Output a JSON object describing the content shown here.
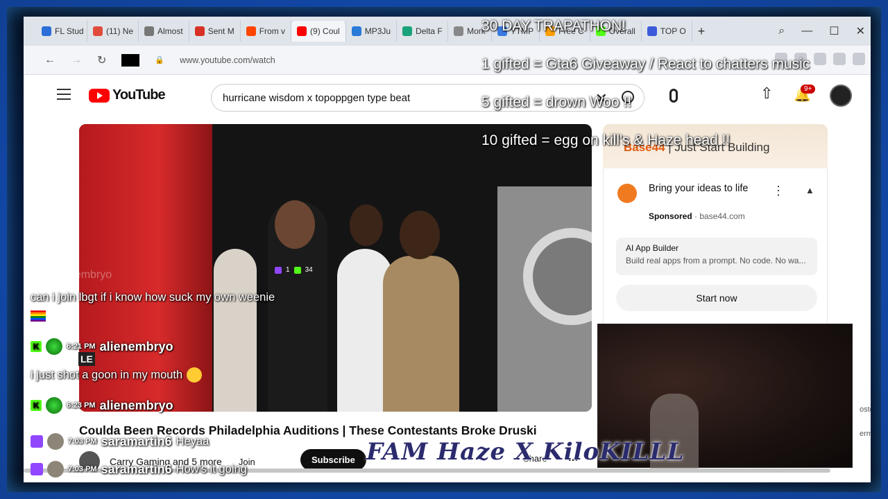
{
  "browser": {
    "tabs": [
      {
        "label": "FL Stud",
        "color": "#2c6fd8"
      },
      {
        "label": "(11) Ne",
        "color": "#e04c3c"
      },
      {
        "label": "Almost",
        "color": "#777777"
      },
      {
        "label": "Sent M",
        "color": "#d93025"
      },
      {
        "label": "From v",
        "color": "#ff4500"
      },
      {
        "label": "(9) Coul",
        "color": "#ff0000",
        "active": true
      },
      {
        "label": "MP3Ju",
        "color": "#2a7ad8"
      },
      {
        "label": "Delta F",
        "color": "#1aa37a"
      },
      {
        "label": "Mork",
        "color": "#888888"
      },
      {
        "label": "YTMP",
        "color": "#3b7be0"
      },
      {
        "label": "Free C",
        "color": "#ffa000"
      },
      {
        "label": "Overall",
        "color": "#53fc18"
      },
      {
        "label": "TOP O",
        "color": "#3b5bdb"
      }
    ],
    "url": "www.youtube.com/watch"
  },
  "youtube": {
    "logo_text": "YouTube",
    "search_value": "hurricane wisdom x topoppgen type beat",
    "notification_count": "9+",
    "video_title": "Coulda Been Records Philadelphia Auditions | These Contestants Broke Druski",
    "channel_meta": "Carry Gaming and 5 more",
    "join_label": "Join",
    "subscribe_label": "Subscribe",
    "share_label": "Share",
    "stream_viewers_twitch": "1",
    "stream_viewers_kick": "34",
    "ad": {
      "banner_brand": "Base44",
      "banner_tagline": "| Just Start Building",
      "headline": "Bring your ideas to life",
      "sponsored_label": "Sponsored",
      "domain": "base44.com",
      "card_title": "AI App Builder",
      "card_desc": "Build real apps from a prompt. No code. No wa...",
      "cta": "Start now"
    },
    "right_snippets": [
      "oste",
      "erm."
    ]
  },
  "overlay": {
    "lines": [
      "30 DAY TRAPATHON!",
      "1 gifted = Gta6 Giveaway / React to chatters music",
      "5 gifted = drown Woo  !!",
      "10 gifted = egg on kill's & Haze head  !!"
    ],
    "logo_text": "FAM Haze X KiloKILLL"
  },
  "chat": {
    "faded_user": "alienembryo",
    "messages": [
      {
        "platform": "kick",
        "time": "",
        "user": "",
        "text": "can i join lbgt if i know how suck my own weenie"
      },
      {
        "platform": "kick",
        "time": "6:21 PM",
        "user": "alienembryo",
        "text": "i just shot a goon in my mouth"
      },
      {
        "platform": "kick",
        "time": "6:23 PM",
        "user": "alienembryo",
        "text": ""
      },
      {
        "platform": "twitch",
        "time": "7:03 PM",
        "user": "saramartin6",
        "text": "Heyaa"
      },
      {
        "platform": "twitch",
        "time": "7:03 PM",
        "user": "saramartin6",
        "text": "How's it going"
      }
    ],
    "le_tag": "LE"
  }
}
